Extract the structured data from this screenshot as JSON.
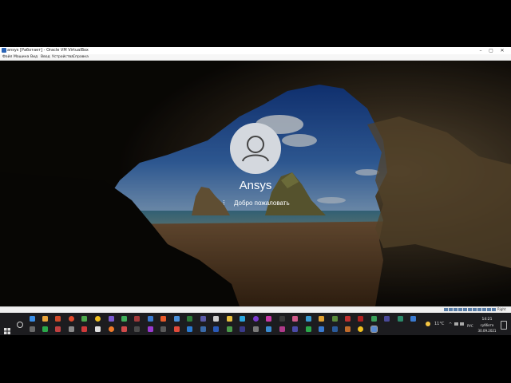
{
  "window": {
    "title": "ansys [Работает] - Oracle VM VirtualBox",
    "minimize_icon": "minimize-icon",
    "maximize_icon": "maximize-icon",
    "close_icon": "close-icon"
  },
  "menu": {
    "items": [
      "Файл",
      "Машина",
      "Вид",
      "Ввод",
      "Устройства",
      "Справка"
    ]
  },
  "lockscreen": {
    "username": "Ansys",
    "status": "Добро пожаловать",
    "avatar_icon": "user-avatar-icon",
    "spinner_icon": "loading-spinner-icon"
  },
  "statusbar": {
    "host_key": "Right Ctrl"
  },
  "taskbar": {
    "start_icon": "windows-start-icon",
    "search_icon": "search-icon",
    "weather": {
      "temp": "11°C",
      "icon": "weather-sun-icon"
    },
    "tray": {
      "language": "РУС",
      "time": "14:21",
      "weekday": "суббота",
      "date": "30.09.2021"
    }
  },
  "colors": {
    "taskbar": "#1c1c1f",
    "titlebar": "#ffffff",
    "avatar": "#d4d8de"
  }
}
